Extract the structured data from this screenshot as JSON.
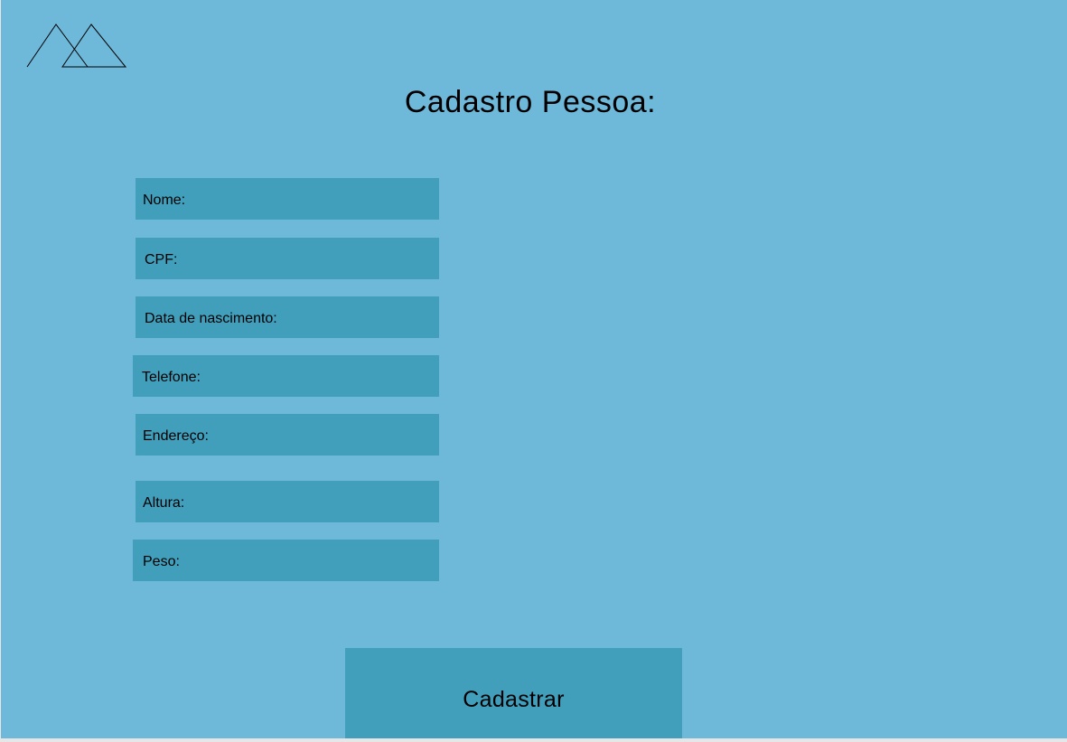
{
  "page": {
    "title": "Cadastro Pessoa:"
  },
  "form": {
    "fields": [
      {
        "label": "Nome:"
      },
      {
        "label": "CPF:"
      },
      {
        "label": "Data de nascimento:"
      },
      {
        "label": "Telefone:"
      },
      {
        "label": "Endereço:"
      },
      {
        "label": "Altura:"
      },
      {
        "label": "Peso:"
      }
    ],
    "submit_label": "Cadastrar"
  },
  "colors": {
    "background": "#6eb8da",
    "field": "#419fbc",
    "text": "#000000"
  },
  "icons": {
    "logo": "mountains-icon"
  }
}
